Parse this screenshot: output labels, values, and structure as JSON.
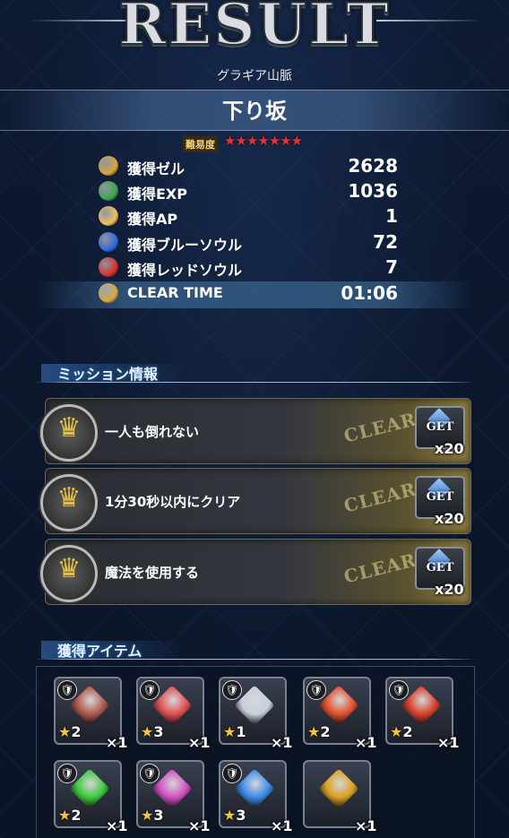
{
  "header": {
    "title": "RESULT",
    "area_name": "グラギア山脈",
    "quest_name": "下り坂",
    "difficulty_label": "難易度",
    "difficulty_stars": 7
  },
  "stats": [
    {
      "label": "獲得ゼル",
      "value": "2628",
      "icon": "gil-coin-icon",
      "color": "#d9a53a"
    },
    {
      "label": "獲得EXP",
      "value": "1036",
      "icon": "exp-icon",
      "color": "#3aa84a"
    },
    {
      "label": "獲得AP",
      "value": "1",
      "icon": "ap-sparkle-icon",
      "color": "#f0c060"
    },
    {
      "label": "獲得ブルーソウル",
      "value": "72",
      "icon": "blue-soul-icon",
      "color": "#2f6ad8"
    },
    {
      "label": "獲得レッドソウル",
      "value": "7",
      "icon": "red-soul-icon",
      "color": "#d83030"
    },
    {
      "label": "CLEAR TIME",
      "value": "01:06",
      "icon": "trophy-icon",
      "color": "#d9a53a"
    }
  ],
  "missions_section": {
    "title": "ミッション情報"
  },
  "missions": [
    {
      "text": "一人も倒れない",
      "status": "CLEAR",
      "reward_button": "GET",
      "reward_qty": "x20"
    },
    {
      "text": "1分30秒以内にクリア",
      "status": "CLEAR",
      "reward_button": "GET",
      "reward_qty": "x20"
    },
    {
      "text": "魔法を使用する",
      "status": "CLEAR",
      "reward_button": "GET",
      "reward_qty": "x20"
    }
  ],
  "items_section": {
    "title": "獲得アイテム"
  },
  "items": [
    {
      "name": "meat-icon",
      "rarity": "2",
      "qty": "×1",
      "color": "#b0584a"
    },
    {
      "name": "red-cloth-icon",
      "rarity": "3",
      "qty": "×1",
      "color": "#e05050"
    },
    {
      "name": "silver-crystal-icon",
      "rarity": "1",
      "qty": "×1",
      "color": "#c8d0dc"
    },
    {
      "name": "fire-crystal-icon",
      "rarity": "2",
      "qty": "×1",
      "color": "#e2502a"
    },
    {
      "name": "fire-crystal-icon",
      "rarity": "2",
      "qty": "×1",
      "color": "#d8402a"
    },
    {
      "name": "wind-crystal-icon",
      "rarity": "2",
      "qty": "×1",
      "color": "#3cc83c"
    },
    {
      "name": "rainbow-crystal-icon",
      "rarity": "3",
      "qty": "×1",
      "color": "#d050c0"
    },
    {
      "name": "water-crystal-icon",
      "rarity": "3",
      "qty": "×1",
      "color": "#3a8ae8"
    },
    {
      "name": "golden-statue-icon",
      "rarity": "",
      "qty": "×1",
      "color": "#d8a020"
    }
  ]
}
